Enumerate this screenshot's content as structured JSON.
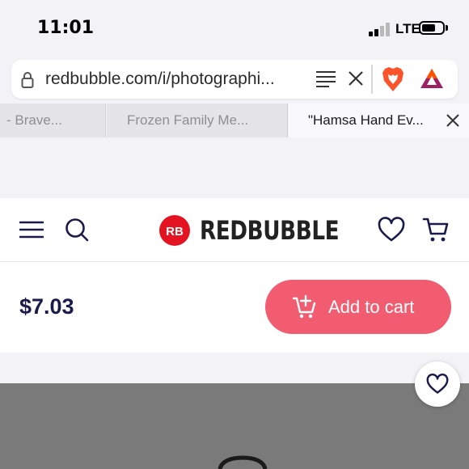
{
  "status_bar": {
    "time": "11:01",
    "network": "LTE",
    "battery_level": 0.65
  },
  "browser": {
    "url": "redbubble.com/i/photographi...",
    "tabs": [
      {
        "label": "- Brave..."
      },
      {
        "label": "Frozen Family Me..."
      },
      {
        "label": "\"Hamsa Hand Ev...",
        "active": true
      }
    ]
  },
  "site": {
    "logo_mark_text": "RB",
    "logo_text": "REDBUBBLE",
    "brand_color": "#e41321"
  },
  "price_bar": {
    "price": "$7.03",
    "add_to_cart_label": "Add to cart",
    "button_color": "#f15c70"
  },
  "icons": [
    "lock-icon",
    "reader-mode-icon",
    "close-icon",
    "brave-lion-icon",
    "bat-rewards-icon",
    "menu-icon",
    "search-icon",
    "heart-icon",
    "cart-icon",
    "add-to-cart-icon"
  ]
}
